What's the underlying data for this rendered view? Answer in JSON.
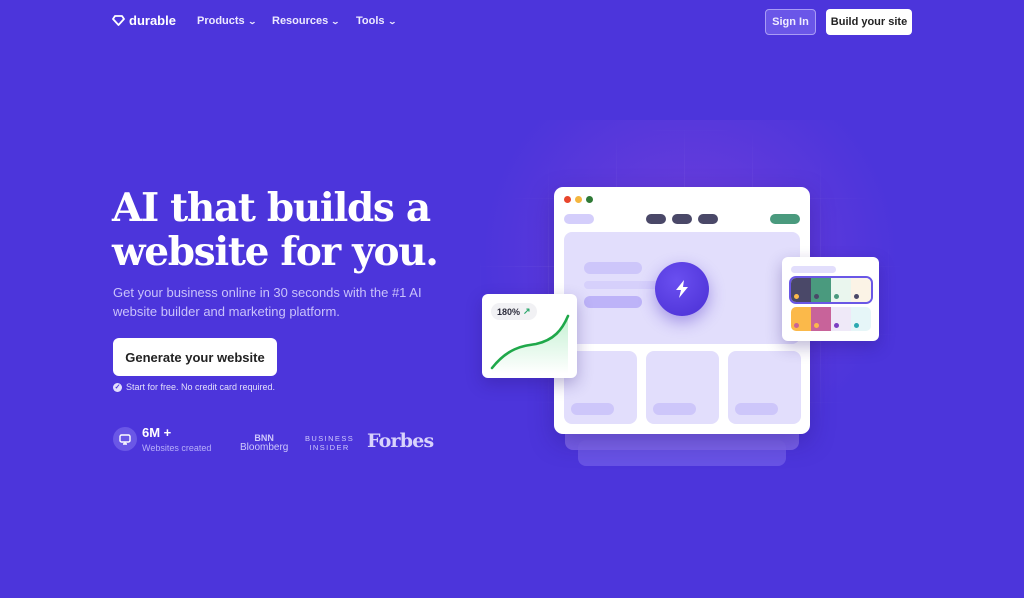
{
  "nav": {
    "brand": "durable",
    "menus": [
      {
        "label": "Products",
        "icon": "chevron-down-icon"
      },
      {
        "label": "Resources",
        "icon": "chevron-down-icon"
      },
      {
        "label": "Tools",
        "icon": "chevron-down-icon"
      }
    ],
    "sign_in": "Sign In",
    "build": "Build your site"
  },
  "hero": {
    "headline_line1": "AI that builds a",
    "headline_line2": "website for you.",
    "subtitle": "Get your business online in 30 seconds with the #1 AI website builder and marketing platform.",
    "cta": "Generate your website",
    "note": "Start for free. No credit card required."
  },
  "stats": {
    "value": "6M +",
    "label": "Websites created",
    "icon": "monitor-icon"
  },
  "press": {
    "bnn_line1": "BNN",
    "bnn_line2": "Bloomberg",
    "bi_line1": "BUSINESS",
    "bi_line2": "INSIDER",
    "forbes": "Forbes"
  },
  "illustration": {
    "growth_badge": "180%",
    "growth_icon": "arrow-up-right-icon",
    "center_icon": "lightning-bolt-icon",
    "colors": {
      "accent": "#4c35db",
      "nav_dark": "#4a4868",
      "nav_green": "#4a9a7e",
      "window_dot_red": "#e8452c",
      "window_dot_yellow": "#f4b63f",
      "window_dot_green": "#2f7a36"
    },
    "palette_rows": [
      [
        "#4a4868",
        "#4a9a7e",
        "#eaf6ee",
        "#fbf3e6"
      ],
      [
        "#fbb94a",
        "#c8639a",
        "#efe9f8",
        "#e6f6f8"
      ]
    ],
    "palette_dots": [
      [
        "#fbb94a",
        "#4a4868",
        "#4a9a7e",
        "#4a4868"
      ],
      [
        "#c8639a",
        "#fbb94a",
        "#7b3fc2",
        "#2aa9b0"
      ]
    ]
  }
}
